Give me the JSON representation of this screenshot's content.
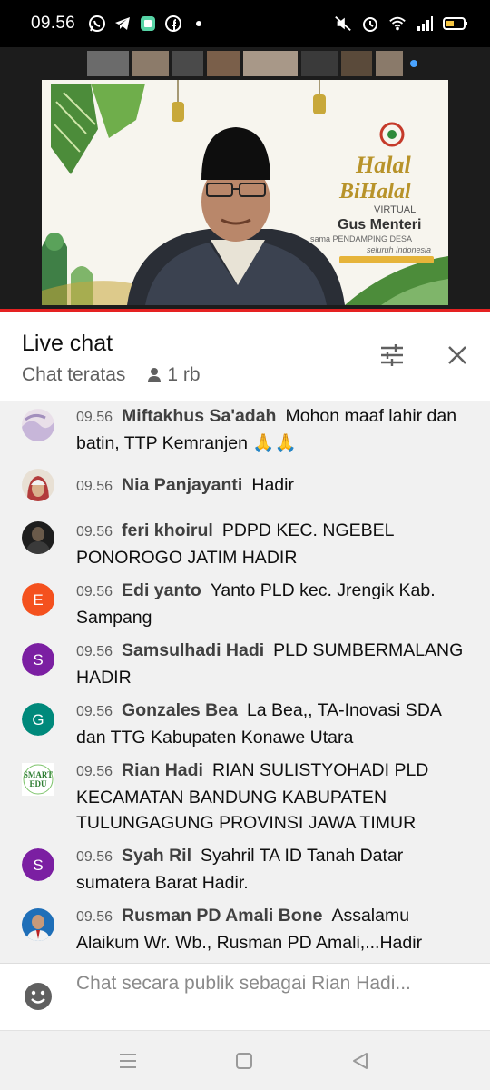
{
  "status_bar": {
    "time": "09.56"
  },
  "video": {
    "banner_line1": "Halal",
    "banner_line2": "BiHalal",
    "banner_virtual": "VIRTUAL",
    "banner_host": "Gus Menteri",
    "banner_with": "sama PENDAMPING DESA",
    "banner_region": "seluruh Indonesia"
  },
  "chat_header": {
    "title": "Live chat",
    "mode": "Chat teratas",
    "viewers": "1 rb"
  },
  "messages": [
    {
      "time": "09.56",
      "author": "Miftakhus Sa'adah",
      "text": "Mohon maaf lahir dan batin, TTP Kemranjen",
      "emoji": "🙏🙏",
      "avatar": {
        "type": "photo",
        "colors": [
          "#c7b6d9",
          "#e9dfe9"
        ]
      }
    },
    {
      "time": "09.56",
      "author": "Nia Panjayanti",
      "text": "Hadir",
      "avatar": {
        "type": "photo",
        "colors": [
          "#d9c2a0",
          "#b23b3b"
        ]
      }
    },
    {
      "time": "09.56",
      "author": "feri khoirul",
      "text": "PDPD KEC. NGEBEL PONOROGO JATIM HADIR",
      "avatar": {
        "type": "photo",
        "colors": [
          "#2c2c2c",
          "#6a5a4a"
        ]
      }
    },
    {
      "time": "09.56",
      "author": "Edi yanto",
      "text": "Yanto PLD kec. Jrengik Kab. Sampang",
      "avatar": {
        "type": "letter",
        "letter": "E",
        "color": "#f4511e"
      }
    },
    {
      "time": "09.56",
      "author": "Samsulhadi Hadi",
      "text": "PLD SUMBERMALANG HADIR",
      "avatar": {
        "type": "letter",
        "letter": "S",
        "color": "#7b1fa2"
      }
    },
    {
      "time": "09.56",
      "author": "Gonzales Bea",
      "text": "La Bea,, TA-Inovasi SDA dan TTG Kabupaten Konawe Utara",
      "avatar": {
        "type": "letter",
        "letter": "G",
        "color": "#00897b"
      }
    },
    {
      "time": "09.56",
      "author": "Rian Hadi",
      "text": "RIAN SULISTYOHADI PLD KECAMATAN BANDUNG KABUPATEN TULUNGAGUNG PROVINSI JAWA TIMUR",
      "avatar": {
        "type": "logo",
        "line1": "SMART",
        "line2": "EDU"
      }
    },
    {
      "time": "09.56",
      "author": "Syah Ril",
      "text": "Syahril TA ID Tanah Datar sumatera Barat Hadir.",
      "avatar": {
        "type": "letter",
        "letter": "S",
        "color": "#7b1fa2"
      }
    },
    {
      "time": "09.56",
      "author": "Rusman PD Amali Bone",
      "text": "Assalamu Alaikum Wr. Wb., Rusman PD Amali,...Hadir",
      "avatar": {
        "type": "photo",
        "colors": [
          "#1f6fb8",
          "#e8d1b5"
        ]
      }
    }
  ],
  "chat_input": {
    "placeholder": "Chat secara publik sebagai Rian Hadi..."
  },
  "icons": {
    "tune": "tune-icon",
    "close": "close-icon",
    "emoji": "emoji-icon",
    "person": "person-icon"
  }
}
